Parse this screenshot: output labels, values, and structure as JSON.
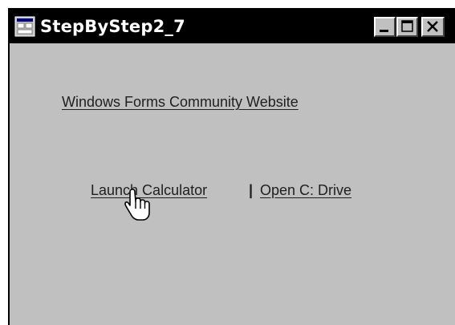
{
  "window": {
    "title": "StepByStep2_7"
  },
  "links": {
    "community": "Windows Forms Community Website",
    "calculator": "Launch Calculator",
    "separator": "|",
    "cdrive": "Open C: Drive"
  },
  "colors": {
    "titlebar": "#000000",
    "window_bg": "#c0c0c0",
    "link_text": "#202020"
  },
  "icons": {
    "app": "window-app-icon",
    "minimize": "minimize-icon",
    "maximize": "maximize-icon",
    "close": "close-icon",
    "cursor": "hand-pointer-cursor-icon"
  }
}
